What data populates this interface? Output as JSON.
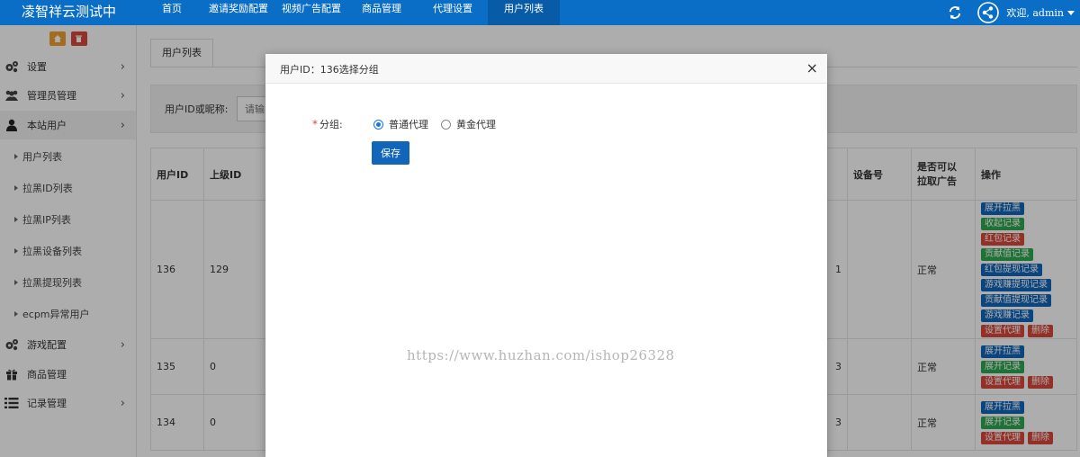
{
  "header": {
    "brand": "凌智祥云测试中",
    "nav": [
      {
        "label": "首页",
        "active": false
      },
      {
        "label": "邀请奖励配置",
        "active": false
      },
      {
        "label": "视频广告配置",
        "active": false
      },
      {
        "label": "商品管理",
        "active": false
      },
      {
        "label": "代理设置",
        "active": false
      },
      {
        "label": "用户列表",
        "active": true
      }
    ],
    "welcome": "欢迎, admin",
    "accent_color": "#0b6ec6"
  },
  "sidebar": {
    "menu": [
      {
        "label": "设置",
        "icon": "gears-icon",
        "chevron": "›"
      },
      {
        "label": "管理员管理",
        "icon": "users-icon",
        "chevron": "›"
      },
      {
        "label": "本站用户",
        "icon": "user-icon",
        "chevron": "›"
      },
      {
        "label": "游戏配置",
        "icon": "gears-icon",
        "chevron": "›"
      },
      {
        "label": "商品管理",
        "icon": "gift-icon",
        "chevron": ""
      },
      {
        "label": "记录管理",
        "icon": "list-icon",
        "chevron": "›"
      }
    ],
    "submenu": [
      {
        "label": "用户列表"
      },
      {
        "label": "拉黑ID列表"
      },
      {
        "label": "拉黑IP列表"
      },
      {
        "label": "拉黑设备列表"
      },
      {
        "label": "拉黑提现列表"
      },
      {
        "label": "ecpm异常用户"
      }
    ]
  },
  "main": {
    "tab": "用户列表",
    "search": {
      "label": "用户ID或昵称:",
      "placeholder": "请输"
    },
    "table": {
      "headers": [
        "用户ID",
        "上级ID",
        "",
        "设备号",
        "是否可以\n拉取广告",
        "操作"
      ],
      "rows": [
        {
          "id": "136",
          "parent": "129",
          "partial": "1",
          "device": "",
          "status": "正常"
        },
        {
          "id": "135",
          "parent": "0",
          "partial": "3",
          "device": "",
          "status": "正常"
        },
        {
          "id": "134",
          "parent": "0",
          "partial": "3",
          "device": "",
          "status": "正常"
        }
      ],
      "ops_row1": [
        [
          "展开拉黑"
        ],
        [
          "收起记录"
        ],
        [
          "红包记录"
        ],
        [
          "贡献值记录"
        ],
        [
          "红包提现记录"
        ],
        [
          "游戏赚提现记录"
        ],
        [
          "贡献值提现记录"
        ],
        [
          "游戏赚记录"
        ],
        [
          "设置代理",
          "删除"
        ]
      ],
      "ops_row_short": [
        [
          "展开拉黑"
        ],
        [
          "展开记录"
        ],
        [
          "设置代理",
          "删除"
        ]
      ]
    }
  },
  "modal": {
    "title": "用户ID：136选择分组",
    "close": "×",
    "field_label": "分组:",
    "required_mark": "*",
    "options": [
      {
        "label": "普通代理",
        "checked": true
      },
      {
        "label": "黄金代理",
        "checked": false
      }
    ],
    "save_label": "保存"
  },
  "watermark": "https://www.huzhan.com/ishop26328"
}
